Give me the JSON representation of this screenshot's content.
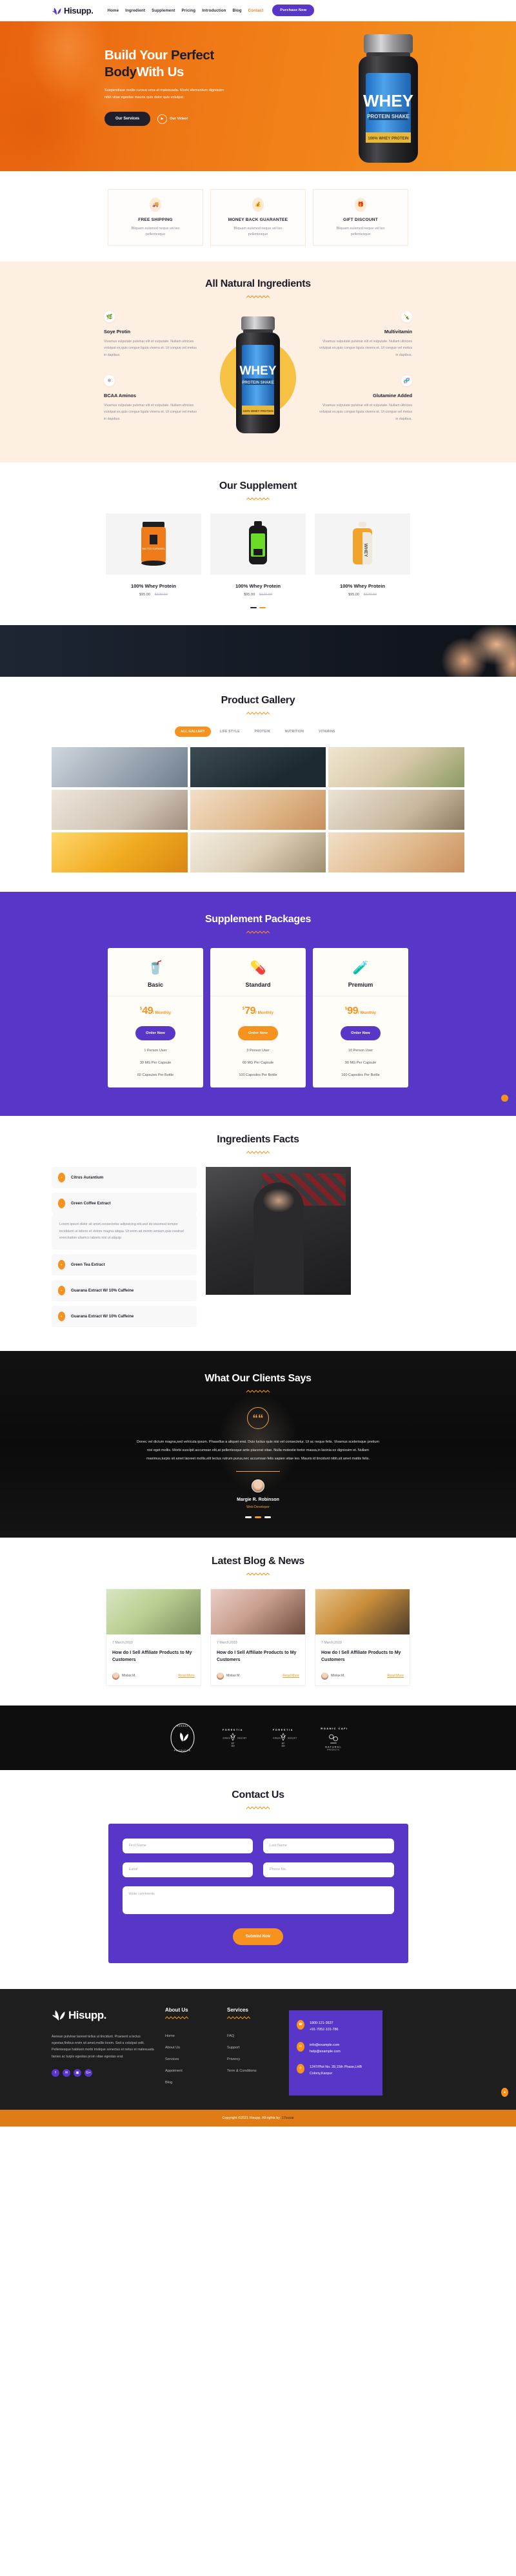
{
  "header": {
    "logo_text": "Hisupp.",
    "nav": [
      {
        "label": "Home",
        "active": false
      },
      {
        "label": "Ingredient",
        "active": false
      },
      {
        "label": "Supplement",
        "active": false
      },
      {
        "label": "Pricing",
        "active": false
      },
      {
        "label": "Introduction",
        "active": false
      },
      {
        "label": "Blog",
        "active": false
      },
      {
        "label": "Contact",
        "active": true
      }
    ],
    "purchase_label": "Purchase Now"
  },
  "hero": {
    "title_1": "Build Your ",
    "title_2": "Perfect",
    "title_3": "Body",
    "title_4": "With Us",
    "subtitle": "Suspendisse mollis cursus urna at malesuada. Morbi elementum dignissim nibh vitae egestas mauris quis dolor quis volutpat.",
    "primary_btn": "Our Services",
    "video_btn": "Our Video!"
  },
  "features": [
    {
      "title": "FREE SHIPPING",
      "desc": "Bliquam euismod neque vel leo pellentesque",
      "icon": "truck-icon"
    },
    {
      "title": "MONEY BACK GUARANTEE",
      "desc": "Bliquam euismod neque vel leo pellentesque",
      "icon": "refund-icon"
    },
    {
      "title": "GIFT DISCOUNT",
      "desc": "Bliquam euismod neque vel leo pellentesque",
      "icon": "gift-icon"
    }
  ],
  "ingredients": {
    "title": "All Natural Ingredients",
    "left": [
      {
        "name": "Soye Protin",
        "desc": "Vivamus vulputate pulvinar elit et vulputate. Nullam ultricies volutpat ex,quis congue ligula viverra et. Ut congue vel metus in dapibus.",
        "icon": "leaf-icon"
      },
      {
        "name": "BCAA Aminos",
        "desc": "Vivamus vulputate pulvinar elit et vulputate. Nullam ultricies volutpat ex,quis congue ligula viverra et. Ut congue vel metus in dapibus.",
        "icon": "molecule-icon"
      }
    ],
    "right": [
      {
        "name": "Multivitamin",
        "desc": "Vivamus vulputate pulvinar elit et vulputate. Nullam ultricies volutpat ex,quis congue ligula viverra et. Ut congue vel metus in dapibus.",
        "icon": "bottle-icon"
      },
      {
        "name": "Glutamine Added",
        "desc": "Vivamus vulputate pulvinar elit et vulputate. Nullam ultricies volutpat ex,quis congue ligula viverra et. Ut congue vel metus in dapibus.",
        "icon": "dna-icon"
      }
    ],
    "product_label_main": "WHEY",
    "product_label_sub": "PROTEIN SHAKE",
    "product_label_foot": "100% WHEY PROTEIN"
  },
  "supplement": {
    "title": "Our Supplement",
    "products": [
      {
        "name": "100% Whey Protein",
        "price": "$95.00",
        "old_price": "$120.00"
      },
      {
        "name": "100% Whey Protein",
        "price": "$95.00",
        "old_price": "$120.00"
      },
      {
        "name": "100% Whey Protein",
        "price": "$95.00",
        "old_price": "$120.00"
      }
    ]
  },
  "gallery": {
    "title": "Product Gallery",
    "filters": [
      {
        "label": "ALL GALLERY",
        "active": true
      },
      {
        "label": "LIFE STYLE",
        "active": false
      },
      {
        "label": "PROTEIN",
        "active": false
      },
      {
        "label": "NUTRITION",
        "active": false
      },
      {
        "label": "VITAMINS",
        "active": false
      }
    ]
  },
  "packages": {
    "title": "Supplement Packages",
    "plans": [
      {
        "name": "Basic",
        "currency": "$",
        "amount": "49",
        "period": "/ Monthly",
        "button": "Order Now",
        "highlight": false,
        "icon": "green-bottle-icon",
        "features": [
          "1 Person User",
          "30 MG Per Capsule",
          "60 Capsules Per Bottle"
        ]
      },
      {
        "name": "Standard",
        "currency": "$",
        "amount": "79",
        "period": "/ Monthly",
        "button": "Order Now",
        "highlight": true,
        "icon": "energy-bottle-icon",
        "features": [
          "3 Person User",
          "60 MG Per Capsule",
          "100 Capsules Per Bottle"
        ]
      },
      {
        "name": "Premium",
        "currency": "$",
        "amount": "99",
        "period": "/ Monthly",
        "button": "Order Now",
        "highlight": false,
        "icon": "vial-icon",
        "features": [
          "10 Person User",
          "90 MG Per Capsule",
          "160 Capsules Per Bottle"
        ]
      }
    ]
  },
  "facts": {
    "title": "Ingredients Facts",
    "items": [
      {
        "label": "Citrus Aurantium",
        "open": false
      },
      {
        "label": "Green Coffee Extract",
        "open": true
      },
      {
        "label": "Green Tea Extract",
        "open": false
      },
      {
        "label": "Guarana Extract W/ 10% Caffeine",
        "open": false
      },
      {
        "label": "Guarana Extract W/ 10% Caffeine",
        "open": false
      }
    ],
    "open_body": "Lorem ipsum dolor sit amet,consectetur adipisicing elit,sed do eiusmod tempor incididunt ut labore et dolore magna aliqua. Ut enim ad minim veniam,quis nostrud exercitation ullamco laboris nisi ut aliquip"
  },
  "testimonial": {
    "title": "What Our Clients Says",
    "quote": "Donec vel dictum magna,sed vehicula ipsum. Phasellus a aliquet erat. Duis luctus quis nisi vel consectetur. Ut ac neque felis. Vivamus scelerisque pretium nisi eget mollis. Morbi suscipit accumsan elit,at pellentesque ante placerat vitae. Nulla molestie tortor massa,in lacinia ex dignissim et. Nullam maximus,turpis sit amet laoreet mollis,elit lectus rutrum purus,nec accumsan felis sapien vitae leo. Mauris id tincidunt nibh,sit amet mattis felis.",
    "name": "Margie R. Robinson",
    "role": "Web Developer"
  },
  "blog": {
    "title": "Latest Blog & News",
    "posts": [
      {
        "date": "7 March,2019",
        "title": "How do I Sell Affiliate Products to My Customers",
        "author": "Mixlax M.",
        "read_more": "Read More"
      },
      {
        "date": "7 March,2019",
        "title": "How do I Sell Affiliate Products to My Customers",
        "author": "Mixlax M.",
        "read_more": "Read More"
      },
      {
        "date": "7 March,2019",
        "title": "How do I Sell Affiliate Products to My Customers",
        "author": "Mixlax M.",
        "read_more": "Read More"
      }
    ]
  },
  "brands": [
    {
      "name": "HERBAL HOUSE ORGANIC PRODUCTS"
    },
    {
      "name": "FORESTIA GREEN RESORT EST 2019"
    },
    {
      "name": "FORESTIA GREEN RESORT EST 2019"
    },
    {
      "name": "ORGANIC CAFE NATURAL PRODUCTS"
    }
  ],
  "contact": {
    "title": "Contact Us",
    "first_name_placeholder": "First Name",
    "last_name_placeholder": "Last Name",
    "email_placeholder": "Eamil",
    "phone_placeholder": "Phone No.",
    "comments_placeholder": "Write comments",
    "submit_label": "Submint Now"
  },
  "footer": {
    "logo_text": "Hisupp.",
    "description": "Aenean pulvinar laoreet tellus ut tincidunt. Praesent a lectus egestas,finibus enim sit amet,mollis lorem. Sed a volutpat velit. Pellentesque habitant morbi tristique senectus et netus et malesuada fames ac turpis egestas proin vitae egestas erat.",
    "social": [
      {
        "name": "facebook-icon",
        "glyph": "f"
      },
      {
        "name": "twitter-icon",
        "glyph": "✉"
      },
      {
        "name": "instagram-icon",
        "glyph": "▣"
      },
      {
        "name": "google-plus-icon",
        "glyph": "G+"
      }
    ],
    "columns": [
      {
        "title": "About Us",
        "links": [
          "Home",
          "About Us",
          "Services",
          "Appoiment",
          "Blog"
        ]
      },
      {
        "title": "Services",
        "links": [
          "FAQ",
          "Support",
          "Privercy",
          "Term & Conditions"
        ]
      }
    ],
    "contact_rows": [
      {
        "icon": "phone-icon",
        "line1": "1800-121-3637",
        "line2": "+91-7052-101-786"
      },
      {
        "icon": "mail-icon",
        "line1": "info@example.com",
        "line2": "help@example.com"
      },
      {
        "icon": "location-icon",
        "line1": "1247/Plot No. 39,15th Phase,LHB",
        "line2": "Colony,Kanpur"
      }
    ],
    "copyright": "Copyright ©2021 Hisupp. All rights by",
    "copyright_link": "17sucai"
  },
  "colors": {
    "orange": "#f7921e",
    "purple": "#5836c8",
    "dark": "#1d1d29",
    "cream": "#fdefe1"
  }
}
